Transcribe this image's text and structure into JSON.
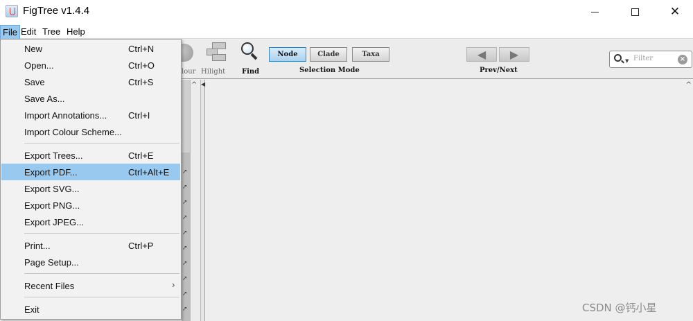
{
  "window": {
    "title": "FigTree v1.4.4"
  },
  "menubar": {
    "items": [
      "File",
      "Edit",
      "Tree",
      "Help"
    ]
  },
  "toolbar": {
    "colour_label": "lour",
    "hilight_label": "Hilight",
    "find_label": "Find",
    "selection_mode": {
      "options": [
        "Node",
        "Clade",
        "Taxa"
      ],
      "selected": "Node",
      "label": "Selection Mode"
    },
    "prev_next_label": "Prev/Next",
    "filter_placeholder": "Filter"
  },
  "file_menu": {
    "items": [
      {
        "label": "New",
        "accel": "Ctrl+N"
      },
      {
        "label": "Open...",
        "accel": "Ctrl+O"
      },
      {
        "label": "Save",
        "accel": "Ctrl+S"
      },
      {
        "label": "Save As...",
        "accel": ""
      },
      {
        "label": "Import Annotations...",
        "accel": "Ctrl+I"
      },
      {
        "label": "Import Colour Scheme...",
        "accel": ""
      },
      {
        "label": "Export Trees...",
        "accel": "Ctrl+E"
      },
      {
        "label": "Export PDF...",
        "accel": "Ctrl+Alt+E",
        "highlighted": true
      },
      {
        "label": "Export SVG...",
        "accel": ""
      },
      {
        "label": "Export PNG...",
        "accel": ""
      },
      {
        "label": "Export JPEG...",
        "accel": ""
      },
      {
        "label": "Print...",
        "accel": "Ctrl+P"
      },
      {
        "label": "Page Setup...",
        "accel": ""
      },
      {
        "label": "Recent Files",
        "accel": "",
        "submenu": true
      },
      {
        "label": "Exit",
        "accel": ""
      }
    ]
  },
  "watermark": "CSDN @钙小星",
  "colors": {
    "highlight": "#99c9ef",
    "selected_segment": "#a9d2f2"
  }
}
